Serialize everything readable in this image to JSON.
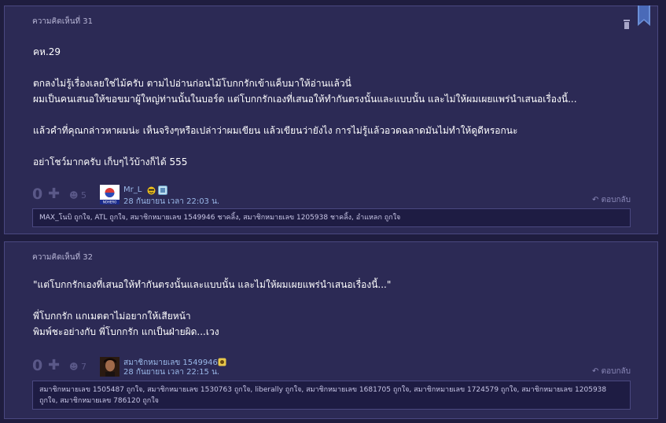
{
  "comments": [
    {
      "number_label": "ความคิดเห็นที่ 31",
      "body": "คห.29\n\nตกลงไม่รู้เรื่องเลยใช่ไม้ครับ ตามไปอ่านก่อนไม้โบกกรักเข้าแค็บมาให้อ่านแล้วนี่\nผมเป็นคนเสนอให้ขอขมาผู้ใหญ่ท่านนั้นในบอร์ด แต่โบกกรักเองที่เสนอให้ทำกันตรงนั้นและแบบนั้น และไม่ให้ผมเผยแพร่นำเสนอเรื่องนี้...\n\nแล้วคำที่คุณกล่าวหาผมน่ะ เห็นจริงๆหรือเปล่าว่าผมเขียน แล้วเขียนว่ายังไง การไม่รู้แล้วอวดฉลาดมันไม่ทำให้ดูดีหรอกนะ\n\nอย่าโชว์มากครับ เก็บๆไว้บ้างก็ได้ 555",
      "vote": "0",
      "emoticon_count": "5",
      "username": "Mr_L",
      "date": "28 กันยายน เวลา 22:03 น.",
      "reply_label": "ตอบกลับ",
      "likes": "MAX_โนบิ ถูกใจ, ATL ถูกใจ, สมาชิกหมายเลข 1549946 ชาคลิ้ง, สมาชิกหมายเลข 1205938 ชาคลิ้ง, อำแหลก ถูกใจ"
    },
    {
      "number_label": "ความคิดเห็นที่ 32",
      "body": "\"แต่โบกกรักเองที่เสนอให้ทำกันตรงนั้นและแบบนั้น และไม่ให้ผมเผยแพร่นำเสนอเรื่องนี้...\"\n\nพี่โบกกรัก แกเมตตาไม่อยากให้เสียหน้า\nพิมพ์ชะอย่างกับ พี่โบกกรัก แกเป็นฝ่ายผิด...เวง",
      "vote": "0",
      "emoticon_count": "7",
      "username": "สมาชิกหมายเลข 1549946",
      "date": "28 กันยายน เวลา 22:15 น.",
      "reply_label": "ตอบกลับ",
      "likes": "สมาชิกหมายเลข 1505487 ถูกใจ, สมาชิกหมายเลข 1530763 ถูกใจ, liberally ถูกใจ, สมาชิกหมายเลข 1681705 ถูกใจ, สมาชิกหมายเลข 1724579 ถูกใจ, สมาชิกหมายเลข 1205938 ถูกใจ, สมาชิกหมายเลข 786120 ถูกใจ"
    }
  ],
  "avatar_labels": {
    "c1": "NOHERO"
  },
  "colors": {
    "background": "#1f1d3f",
    "panel": "#2c2a55",
    "accent": "#6b8fd6",
    "link": "#9ab8e8"
  },
  "icons": [
    "bookmark-icon",
    "trash-icon",
    "plus-icon",
    "emoticon-icon",
    "reply-icon",
    "avatar",
    "badge-icon"
  ]
}
